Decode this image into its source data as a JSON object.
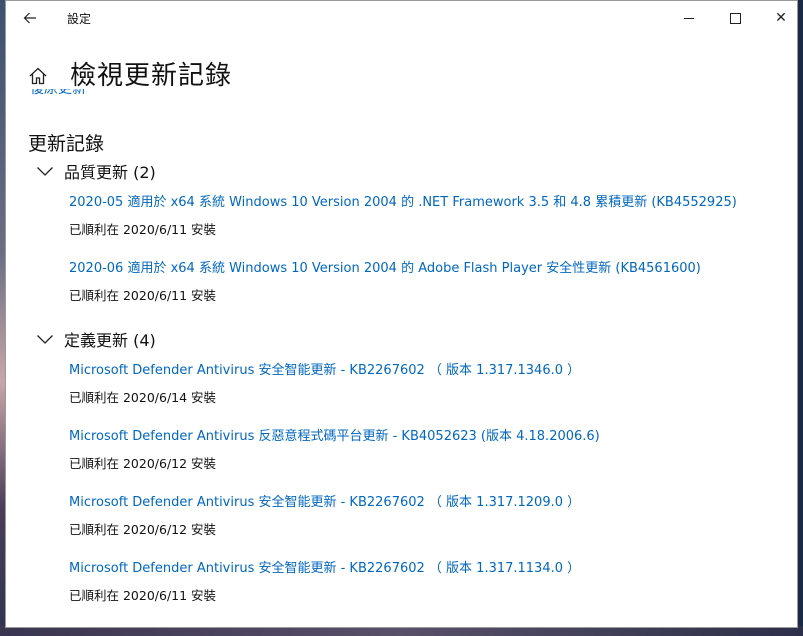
{
  "window": {
    "title": "設定",
    "back_icon": "back-arrow-icon",
    "controls": {
      "minimize_icon": "minimize-icon",
      "maximize_icon": "maximize-icon",
      "close_icon": "close-icon",
      "close_glyph": "✕"
    }
  },
  "header": {
    "home_icon": "home-icon",
    "title": "檢視更新記錄",
    "clipped_link": "復原更新"
  },
  "history": {
    "title": "更新記錄",
    "groups": [
      {
        "label": "品質更新 (2)",
        "items": [
          {
            "name": "2020-05 適用於 x64 系統 Windows 10 Version 2004 的 .NET Framework 3.5 和 4.8 累積更新 (KB4552925)",
            "status": "已順利在 2020/6/11 安裝"
          },
          {
            "name": "2020-06 適用於 x64 系統 Windows 10 Version 2004 的 Adobe Flash Player 安全性更新 (KB4561600)",
            "status": "已順利在 2020/6/11 安裝"
          }
        ]
      },
      {
        "label": "定義更新 (4)",
        "items": [
          {
            "name": "Microsoft Defender Antivirus 安全智能更新 - KB2267602 （ 版本 1.317.1346.0 ）",
            "status": "已順利在 2020/6/14 安裝"
          },
          {
            "name": "Microsoft Defender Antivirus 反惡意程式碼平台更新 - KB4052623 (版本 4.18.2006.6)",
            "status": "已順利在 2020/6/12 安裝"
          },
          {
            "name": "Microsoft Defender Antivirus 安全智能更新 - KB2267602 （ 版本 1.317.1209.0 ）",
            "status": "已順利在 2020/6/12 安裝"
          },
          {
            "name": "Microsoft Defender Antivirus 安全智能更新 - KB2267602 （ 版本 1.317.1134.0 ）",
            "status": "已順利在 2020/6/11 安裝"
          }
        ]
      }
    ]
  },
  "colors": {
    "link": "#0067c0",
    "text": "#111111",
    "background": "#ffffff"
  }
}
